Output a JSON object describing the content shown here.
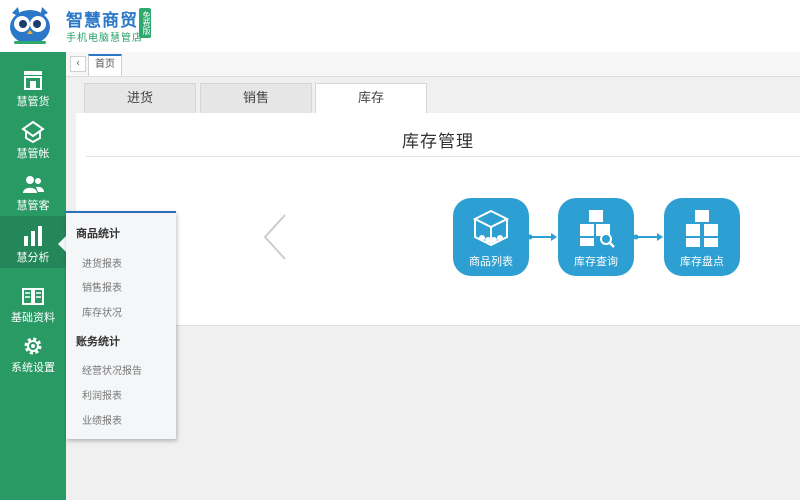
{
  "brand": {
    "title": "智慧商贸",
    "subtitle": "手机电脑慧管店",
    "badge": "免费版"
  },
  "sidebar": {
    "items": [
      {
        "label": "慧管货",
        "icon": "store-icon"
      },
      {
        "label": "慧管帐",
        "icon": "ledger-icon"
      },
      {
        "label": "慧管客",
        "icon": "users-icon"
      },
      {
        "label": "慧分析",
        "icon": "bar-chart-icon",
        "active": true
      },
      {
        "label": "基础资料",
        "icon": "book-icon"
      },
      {
        "label": "系统设置",
        "icon": "gear-icon"
      }
    ]
  },
  "tabstrip": {
    "back_symbol": "‹",
    "home_tab": "首页"
  },
  "section_tabs": [
    {
      "label": "进货"
    },
    {
      "label": "销售"
    },
    {
      "label": "库存",
      "active": true
    }
  ],
  "panel": {
    "title": "库存管理",
    "flow": [
      {
        "label": "商品列表",
        "icon": "product-list-icon"
      },
      {
        "label": "库存查询",
        "icon": "stock-query-icon"
      },
      {
        "label": "库存盘点",
        "icon": "stock-check-icon"
      }
    ]
  },
  "popup_menu": {
    "groups": [
      {
        "heading": "商品统计",
        "items": [
          "进货报表",
          "销售报表",
          "库存状况"
        ]
      },
      {
        "heading": "账务统计",
        "items": [
          "经营状况报告",
          "利润报表",
          "业绩报表"
        ]
      }
    ]
  },
  "colors": {
    "sidebar": "#2a9a64",
    "accent_blue": "#2d9fd2",
    "brand_blue": "#2a78c7",
    "brand_green": "#29a06a"
  }
}
